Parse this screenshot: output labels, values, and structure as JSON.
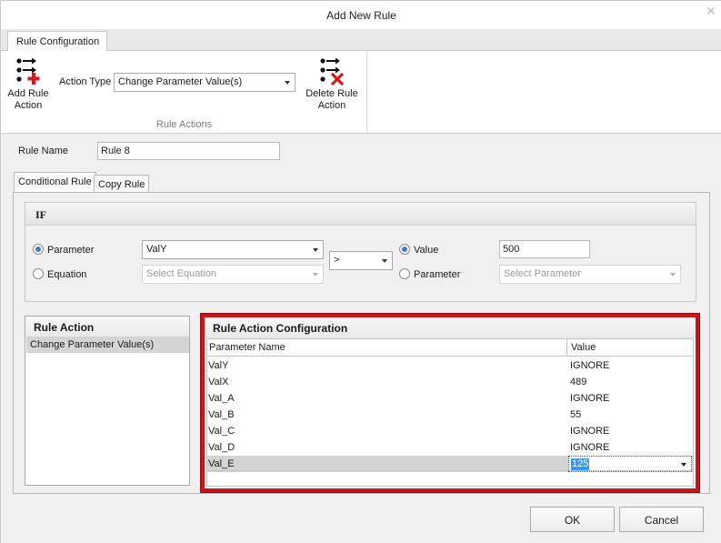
{
  "window": {
    "title": "Add New Rule",
    "close_glyph": "✕"
  },
  "ribbon": {
    "tab_label": "Rule Configuration",
    "add_button_label": "Add Rule Action",
    "action_type_label": "Action Type",
    "action_type_value": "Change Parameter Value(s)",
    "delete_button_label": "Delete Rule Action",
    "group_caption": "Rule Actions",
    "icons": {
      "add": "add-action-icon",
      "delete": "delete-action-icon"
    },
    "colors": {
      "add_plus": "#d6181f",
      "delete_x": "#d6181f"
    }
  },
  "rule_name": {
    "label": "Rule Name",
    "value": "Rule 8"
  },
  "tabs": [
    "Conditional Rule",
    "Copy Rule"
  ],
  "if_panel": {
    "title": "IF",
    "left_options": [
      "Parameter",
      "Equation"
    ],
    "left_selected": "Parameter",
    "parameter_value": "ValY",
    "equation_placeholder": "Select Equation",
    "operator": ">",
    "right_options": [
      "Value",
      "Parameter"
    ],
    "right_selected": "Value",
    "value": "500",
    "parameter_placeholder": "Select Parameter"
  },
  "rule_action": {
    "title": "Rule Action",
    "items": [
      "Change Parameter Value(s)"
    ]
  },
  "config": {
    "title": "Rule Action Configuration",
    "columns": [
      "Parameter Name",
      "Value"
    ],
    "rows": [
      {
        "name": "ValY",
        "value": "IGNORE"
      },
      {
        "name": "ValX",
        "value": "489"
      },
      {
        "name": "Val_A",
        "value": "IGNORE"
      },
      {
        "name": "Val_B",
        "value": "55"
      },
      {
        "name": "Val_C",
        "value": "IGNORE"
      },
      {
        "name": "Val_D",
        "value": "IGNORE"
      },
      {
        "name": "Val_E",
        "value": "125"
      }
    ],
    "selected_row": "Val_E",
    "highlight_color": "#c4161c"
  },
  "buttons": {
    "ok": "OK",
    "cancel": "Cancel"
  }
}
